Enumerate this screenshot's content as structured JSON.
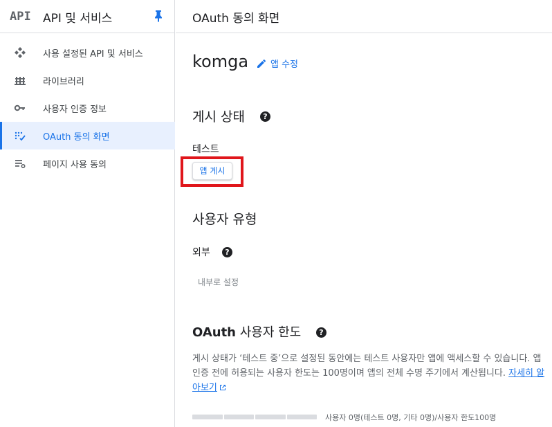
{
  "sidebar": {
    "logo": "API",
    "title": "API 및 서비스",
    "items": [
      {
        "label": "사용 설정된 API 및 서비스",
        "icon": "api-diamond-icon"
      },
      {
        "label": "라이브러리",
        "icon": "library-icon"
      },
      {
        "label": "사용자 인증 정보",
        "icon": "key-icon"
      },
      {
        "label": "OAuth 동의 화면",
        "icon": "oauth-consent-icon",
        "active": true
      },
      {
        "label": "페이지 사용 동의",
        "icon": "settings-list-icon"
      }
    ]
  },
  "topbar": {
    "title": "OAuth 동의 화면"
  },
  "app": {
    "name": "komga",
    "edit_label": "앱 수정"
  },
  "publishing": {
    "title": "게시 상태",
    "status": "테스트",
    "publish_button": "앱 게시"
  },
  "user_type": {
    "title": "사용자 유형",
    "value": "외부",
    "internal_button": "내부로 설정"
  },
  "user_limit": {
    "title_bold": "OAuth",
    "title_rest": " 사용자 한도",
    "description": "게시 상태가 ‘테스트 중’으로 설정된 동안에는 테스트 사용자만 앱에 액세스할 수 있습니다. 앱 인증 전에 허용되는 사용자 한도는 100명이며 앱의 전체 수명 주기에서 계산됩니다. ",
    "learn_more": "자세히 알아보기",
    "progress_fraction": 0,
    "progress_label": "사용자 0명(테스트 0명, 기타 0명)/사용자 한도100명"
  },
  "help_glyph": "?",
  "colors": {
    "accent": "#1a73e8",
    "highlight": "#e0161b"
  }
}
